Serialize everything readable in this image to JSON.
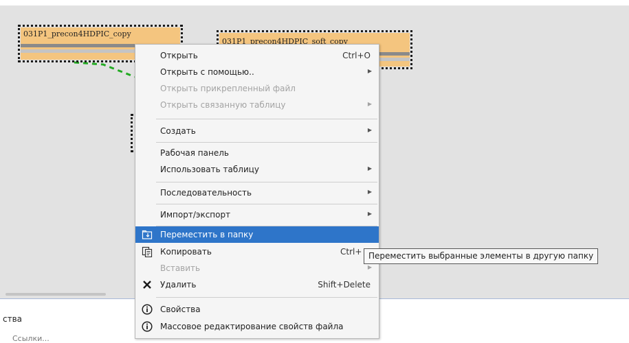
{
  "canvas": {
    "nodes": [
      {
        "title": "031P1_precon4HDPIC_copy"
      },
      {
        "title": "031P1_precon4HDPIC_soft_copy"
      }
    ],
    "link_color": "#22aa22",
    "background": "#e2e2e2"
  },
  "bottom_panel": {
    "label": "ства",
    "sublabel": "Ссылки..."
  },
  "context_menu": {
    "items": [
      {
        "label": "Открыть",
        "shortcut": "Ctrl+O",
        "submenu": false,
        "disabled": false
      },
      {
        "label": "Открыть с помощью..",
        "submenu": true,
        "disabled": false
      },
      {
        "label": "Открыть прикрепленный файл",
        "submenu": false,
        "disabled": true
      },
      {
        "label": "Открыть связанную таблицу",
        "submenu": true,
        "disabled": true
      },
      {
        "label": "Создать",
        "submenu": true,
        "disabled": false
      },
      {
        "label": "Рабочая панель",
        "submenu": false,
        "disabled": false
      },
      {
        "label": "Использовать таблицу",
        "submenu": true,
        "disabled": false
      },
      {
        "label": "Последовательность",
        "submenu": true,
        "disabled": false
      },
      {
        "label": "Импорт/экспорт",
        "submenu": true,
        "disabled": false
      },
      {
        "label": "Переместить в папку",
        "icon": "move-to-folder-icon",
        "highlighted": true
      },
      {
        "label": "Копировать",
        "shortcut": "Ctrl+",
        "icon": "copy-icon"
      },
      {
        "label": "Вставить",
        "submenu": true,
        "disabled": true
      },
      {
        "label": "Удалить",
        "shortcut": "Shift+Delete",
        "icon": "delete-icon"
      },
      {
        "label": "Свойства",
        "icon": "info-icon"
      },
      {
        "label": "Массовое редактирование свойств файла",
        "icon": "info-icon"
      }
    ],
    "highlight_color": "#2e75c9"
  },
  "tooltip": {
    "text": "Переместить выбранные элементы в другую папку"
  }
}
